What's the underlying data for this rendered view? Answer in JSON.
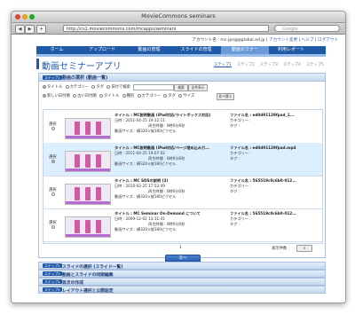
{
  "window": {
    "title": "MovieCommons seminars"
  },
  "browser": {
    "url": "http://cs1.moviecommons.com/mcapps/seminars",
    "search_placeholder": "Google",
    "back": "◀",
    "forward": "▶",
    "plus": "+"
  },
  "header": {
    "account_text": "アカウント名 : mc-jpng@global.ad.jp",
    "account_links": [
      "アカウント変更",
      "ヘルプ",
      "ログアウト"
    ],
    "separator": "|"
  },
  "nav": {
    "items": [
      {
        "label": "ホーム"
      },
      {
        "label": "アップロード"
      },
      {
        "label": "動画の管理"
      },
      {
        "label": "スライドの管理"
      },
      {
        "label": "動画セミナー"
      },
      {
        "label": "利用レポート"
      }
    ],
    "active_index": 4
  },
  "page": {
    "title": "動画セミナーアプリ",
    "steps": [
      "ステップ1",
      "ステップ2",
      "ステップ3",
      "ステップ4",
      "ステップ5"
    ]
  },
  "panel": {
    "badge": "ステップ1",
    "title": "動画の選択 (動画一覧)",
    "filter1": {
      "options": [
        "タイトル",
        "カテゴリー",
        "タグ",
        "日付で検索"
      ],
      "search_button": "検索",
      "show_all_button": "全件表示"
    },
    "filter2": {
      "options": [
        "新しい日付順",
        "古い日付順",
        "タイトル",
        "種別",
        "カテゴリー",
        "タグ",
        "サイズ"
      ],
      "sort_button": "並べ替え"
    },
    "rows": [
      {
        "select_label": "選択",
        "title": "タイトル : MC説明動画 (iPad対応/ライトボックス対応)",
        "date": "日時 : 2011-04-25 19:12:11",
        "duration": "再生時間 : 0時0分6秒",
        "filename": "ファイル名 : ed0d91129fpad_1...",
        "category": "カテゴリー :",
        "size": "動画サイズ : 横320×縦180ピクセル",
        "tag": "タグ :",
        "selected": false
      },
      {
        "select_label": "選択",
        "title": "タイトル : MC説明動画 (iPad対応/ページ埋め込みガ...",
        "date": "日時 : 2011-04-25 19:07:02",
        "duration": "再生時間 : 0時0分6秒",
        "filename": "ファイル名 : ed0d91129fpad.mp4",
        "category": "カテゴリー :",
        "size": "動画サイズ : 横320×縦180ピクセル",
        "tag": "タグ :",
        "selected": true
      },
      {
        "select_label": "選択",
        "title": "タイトル : MC SDSの説明 (2)",
        "date": "日時 : 2010-02-25 17:52:49",
        "duration": "再生時間 : 0時0分0秒",
        "filename": "ファイル名 : 565519c0c6b0-012...",
        "category": "カテゴリー :",
        "size": "動画サイズ : 横320×縦180ピクセル",
        "tag": "タグ :",
        "selected": false
      },
      {
        "select_label": "選択",
        "title": "タイトル : MC Seminar On-Demand について",
        "date": "日時 : 2009-12-02 13:11:41",
        "duration": "再生時間 : 0時0分0秒",
        "filename": "ファイル名 : 565519c0c6b0-012...",
        "category": "カテゴリー :",
        "size": "動画サイズ : 横320×縦180ピクセル",
        "tag": "タグ :",
        "selected": false
      }
    ],
    "pagination": {
      "page": "1",
      "count_label": "表示件数 :",
      "count_value": "5"
    },
    "next_button": "次へ"
  },
  "sections": [
    {
      "badge": "ステップ2",
      "title": "スライドの選択 (スライド一覧)"
    },
    {
      "badge": "ステップ3",
      "title": "動画とスライドの同期編集"
    },
    {
      "badge": "ステップ4",
      "title": "目次の作成"
    },
    {
      "badge": "ステップ5",
      "title": "レイアウト選択と公開設定"
    }
  ],
  "colors": {
    "nav_bg": "#1f5aa8",
    "nav_active": "#6b9ad8",
    "selected_row": "#dcefff",
    "thumb_accent": "#d35aa5"
  }
}
